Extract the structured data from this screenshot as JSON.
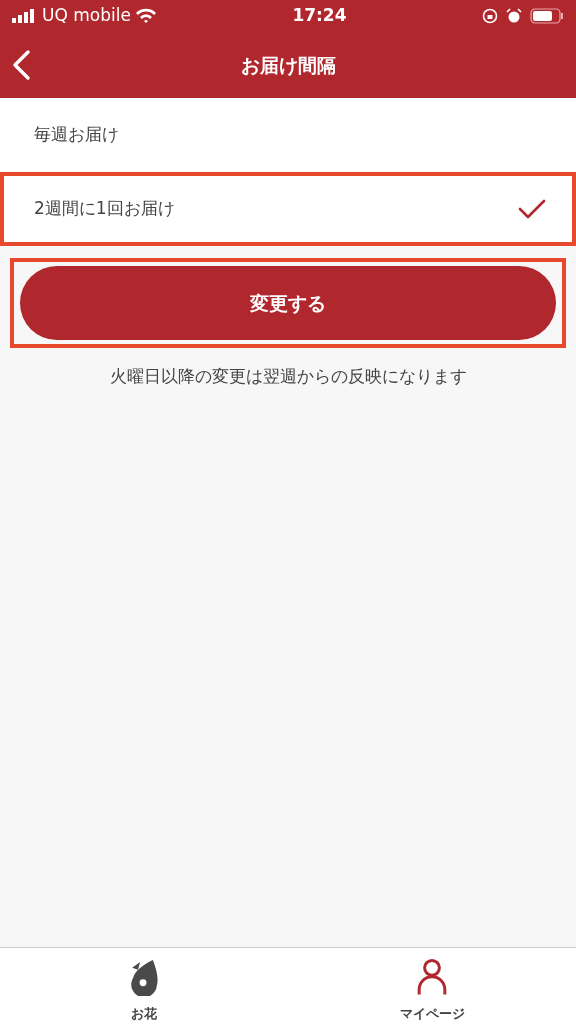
{
  "status_bar": {
    "carrier": "UQ mobile",
    "time": "17:24"
  },
  "header": {
    "title": "お届け間隔"
  },
  "options": [
    {
      "label": "毎週お届け",
      "selected": false,
      "highlighted": false
    },
    {
      "label": "2週間に1回お届け",
      "selected": true,
      "highlighted": true
    }
  ],
  "submit_button": {
    "label": "変更する",
    "highlighted": true
  },
  "note": "火曜日以降の変更は翌週からの反映になります",
  "tab_bar": [
    {
      "label": "お花",
      "kind": "flower",
      "selected": false
    },
    {
      "label": "マイページ",
      "kind": "person",
      "selected": true
    }
  ]
}
